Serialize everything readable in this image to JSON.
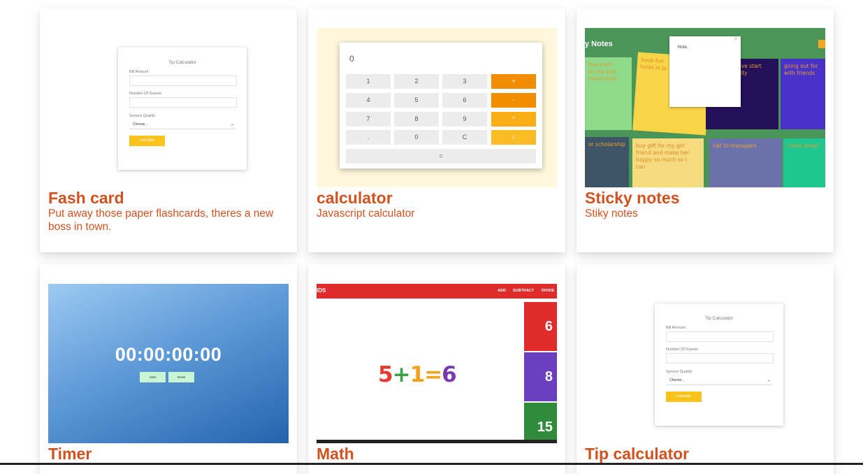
{
  "colors": {
    "title": "#d2521f",
    "accent_yellow": "#f9c21d",
    "calc_orange": "#f28c00",
    "math_red": "#e02b2b"
  },
  "cards": [
    {
      "title": "Fash card",
      "description": "Put away those paper flashcards, theres a new boss in town.",
      "preview": {
        "title": "Tip Calculator",
        "bill_label": "Bill Amount",
        "guests_label": "Number Of Guests",
        "service_label": "Service Quality",
        "select_value": "Choose...",
        "button": "Calculate"
      }
    },
    {
      "title": "calculator",
      "description": "Javascript calculator",
      "preview": {
        "display": "0",
        "keys": [
          "1",
          "2",
          "3",
          "+",
          "4",
          "5",
          "6",
          "-",
          "7",
          "8",
          "9",
          "*",
          ".",
          "0",
          "C",
          "/"
        ],
        "equals": "="
      }
    },
    {
      "title": "Sticky notes",
      "description": "Stiky notes",
      "preview": {
        "header": "y Notes",
        "popup_placeholder": "Note..",
        "popup_close": "✕",
        "notes": [
          "five start\nie city and\nmoon food",
          "book fun\nhotel in la",
          "five start\ncity",
          "going out for\nwith friends",
          "or scholarship",
          "buy gift for my girl\nfriend and make her\nhappy so much so I\ncan",
          "call to managers",
          "check email"
        ]
      }
    },
    {
      "title": "Timer",
      "description": "",
      "preview": {
        "time": "00:00:00:00",
        "start": "Start",
        "reset": "Reset"
      }
    },
    {
      "title": "Math",
      "description": "",
      "preview": {
        "logo": "IDS",
        "menu": [
          "ADD",
          "SUBTRACT",
          "DIVIDE"
        ],
        "equation": {
          "a": "5",
          "op": "+",
          "b": "1",
          "eq": "=",
          "result": "6"
        },
        "tiles": [
          "6",
          "8",
          "15"
        ]
      }
    },
    {
      "title": "Tip calculator",
      "description": "",
      "preview": {
        "title": "Tip Calculator",
        "bill_label": "Bill Amount",
        "guests_label": "Number Of Guests",
        "service_label": "Service Quality",
        "select_value": "Choose...",
        "button": "Calculate"
      }
    }
  ]
}
